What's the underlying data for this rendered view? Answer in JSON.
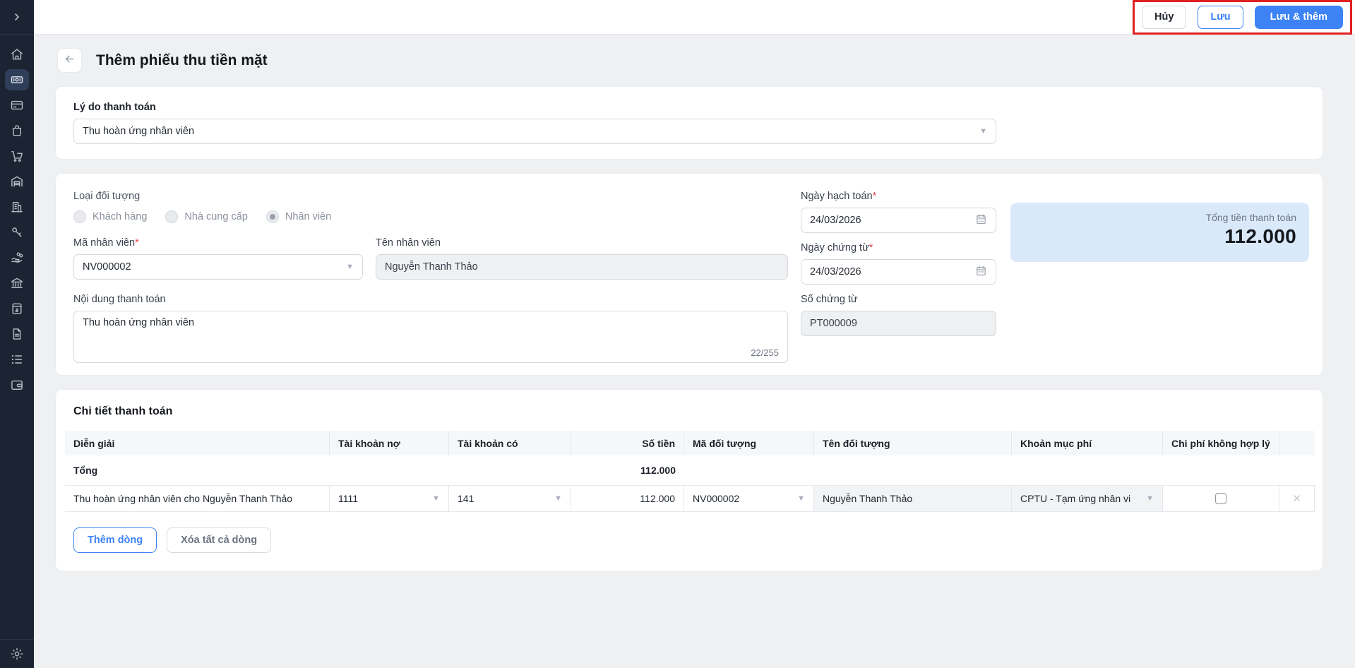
{
  "topbar": {
    "cancel_label": "Hủy",
    "save_label": "Lưu",
    "save_add_label": "Lưu & thêm",
    "annotation_color": "#e02020",
    "accent_color": "#3d83f6"
  },
  "page": {
    "title": "Thêm phiếu thu tiền mặt"
  },
  "sidebar": {
    "icons": [
      "chevron-right",
      "home",
      "cash",
      "credit-card",
      "shopping-bag",
      "shopping-cart",
      "warehouse",
      "building",
      "key",
      "hand-coins",
      "bank",
      "cash-box",
      "document",
      "list",
      "wallet",
      "settings"
    ],
    "active_icon": "cash",
    "bg_color": "#1c2433"
  },
  "reason_section": {
    "label": "Lý do thanh toán",
    "value": "Thu hoàn ứng nhân viên"
  },
  "info_section": {
    "object_type_label": "Loại đối tượng",
    "object_types": [
      {
        "label": "Khách hàng",
        "selected": false
      },
      {
        "label": "Nhà cung cấp",
        "selected": false
      },
      {
        "label": "Nhân viên",
        "selected": true
      }
    ],
    "employee_code": {
      "label": "Mã nhân viên",
      "required": "*",
      "value": "NV000002"
    },
    "employee_name": {
      "label": "Tên nhân viên",
      "value": "Nguyễn Thanh Thảo"
    },
    "payment_content": {
      "label": "Nội dung thanh toán",
      "value": "Thu hoàn ứng nhân viên",
      "counter": "22/255"
    },
    "posting_date": {
      "label": "Ngày hạch toán",
      "required": "*",
      "value": "24/03/2026"
    },
    "document_date": {
      "label": "Ngày chứng từ",
      "required": "*",
      "value": "24/03/2026"
    },
    "document_number": {
      "label": "Số chứng từ",
      "value": "PT000009"
    },
    "total": {
      "label": "Tổng tiền thanh toán",
      "value": "112.000",
      "box_color": "#d9e9fa"
    }
  },
  "detail_section": {
    "title": "Chi tiết thanh toán",
    "columns": [
      "Diễn giải",
      "Tài khoản nợ",
      "Tài khoản có",
      "Số tiền",
      "Mã đối tượng",
      "Tên đối tượng",
      "Khoản mục phí",
      "Chi phí không hợp lý"
    ],
    "total_row": {
      "label": "Tổng",
      "amount": "112.000"
    },
    "rows": [
      {
        "description": "Thu hoàn ứng nhân viên cho Nguyễn Thanh Thảo",
        "debit_account": "1111",
        "credit_account": "141",
        "amount": "112.000",
        "object_code": "NV000002",
        "object_name": "Nguyễn Thanh Thảo",
        "expense_category": "CPTU - Tạm ứng nhân vi",
        "invalid_expense_checked": false
      }
    ],
    "add_row_label": "Thêm dòng",
    "delete_all_label": "Xóa tất cả dòng"
  }
}
